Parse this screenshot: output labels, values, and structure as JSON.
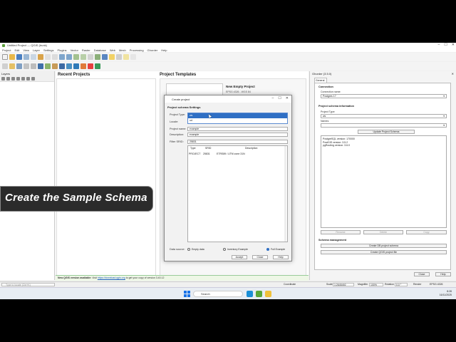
{
  "window": {
    "title": "Untitled Project — QGIS (trunk)",
    "controls": [
      "–",
      "☐",
      "✕"
    ]
  },
  "menu": [
    "Project",
    "Edit",
    "View",
    "Layer",
    "Settings",
    "Plugins",
    "Vector",
    "Raster",
    "Database",
    "Web",
    "Mesh",
    "Processing",
    "Ghorder",
    "Help"
  ],
  "layers_panel": {
    "title": "Layers"
  },
  "welcome": {
    "recent_title": "Recent Projects",
    "templates_title": "Project Templates",
    "template_name": "New Empty Project",
    "template_crs": "EPSG:4326 - WGS 84"
  },
  "news": {
    "prefix": "New QGIS version available:",
    "text1": "Visit",
    "link": "https://download.qgis.org",
    "text2": "to get your copy of version 3.40.12"
  },
  "ghorder": {
    "title": "Ghorder (3.5.0)",
    "tab": "General",
    "connection_section": "Connection",
    "connection_label": "Connection name:",
    "connection_value": "Postgres 17",
    "schema_section": "Project schema information",
    "project_type_label": "Project Type:",
    "project_type_value": "ws",
    "names_label": "Names:",
    "update_button": "Update Project Schema",
    "info_lines": [
      "PostgreSQL version: 170000",
      "PostGIS version: 3.5.2",
      "pgRouting version: 3.6.0"
    ],
    "rename_button": "Rename",
    "delete_button": "Delete",
    "copy_button": "Copy",
    "management_section": "Schema management",
    "create_db_button": "Create DB project schema",
    "create_qgis_button": "Create QGIS project file",
    "close_button": "Close",
    "help_button": "Help"
  },
  "dialog": {
    "title": "Create project",
    "section": "Project schema Settings",
    "project_type_label": "Project Type:",
    "locale_label": "Locale:",
    "project_name_label": "Project name:",
    "project_name_value": "example",
    "description_label": "Description:",
    "description_value": "example",
    "filter_srid_label": "Filter SRID:",
    "filter_srid_value": "25831",
    "dropdown_options": [
      "ws",
      "ud"
    ],
    "table_headers": [
      "Type",
      "SRID",
      "Description"
    ],
    "table_row": [
      "PROJECT",
      "25831",
      "ETRS89 / UTM zone 31N"
    ],
    "data_source_label": "Data source:",
    "radio_empty": "Empty data",
    "radio_inventory": "Inventory Example",
    "radio_full": "Full Example",
    "accept_button": "Accept",
    "close_button": "Close",
    "help_button": "Help"
  },
  "overlay": {
    "caption": "Create the Sample Schema"
  },
  "statusbar": {
    "locator_placeholder": "Type to locate (Ctrl+K)",
    "coordinate_label": "Coordinate",
    "scale_label": "Scale",
    "scale_value": "1:2645492",
    "magnifier_label": "Magnifier",
    "magnifier_value": "100%",
    "rotation_label": "Rotation",
    "rotation_value": "0.0 °",
    "render_label": "Render",
    "crs": "EPSG:4326"
  },
  "taskbar": {
    "search": "Search",
    "time": "8:28",
    "date": "16/11/2025"
  },
  "colors": {
    "accent": "#2f6fc4",
    "overlay_bg": "#2b2b2b",
    "news_bg": "#eef7e6"
  }
}
